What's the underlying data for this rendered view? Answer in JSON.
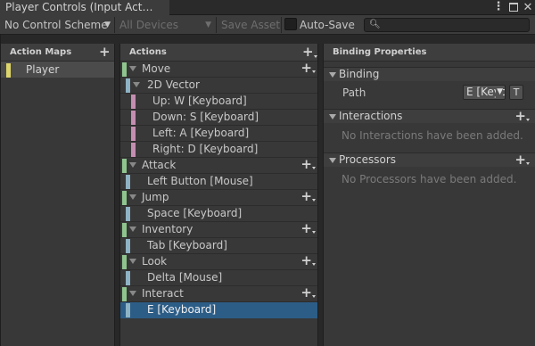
{
  "window": {
    "tab_title": "Player Controls (Input Act…",
    "kebab_glyph": "⋮",
    "close_glyph": "✕"
  },
  "toolbar": {
    "control_scheme": "No Control Scheme",
    "devices": "All Devices",
    "save_asset": "Save Asset",
    "auto_save": "Auto-Save",
    "search_placeholder": "",
    "auto_save_checked": false
  },
  "action_maps": {
    "header": "Action Maps",
    "items": [
      {
        "label": "Player",
        "color": "#ddd56b"
      }
    ]
  },
  "actions": {
    "header": "Actions",
    "colors": {
      "action": "#8fc48f",
      "binding": "#8eb3c4",
      "part": "#c48eb0"
    },
    "rows": [
      {
        "label": "Move",
        "kind": "action"
      },
      {
        "label": "2D Vector",
        "kind": "composite"
      },
      {
        "label": "Up: W [Keyboard]",
        "kind": "part"
      },
      {
        "label": "Down: S [Keyboard]",
        "kind": "part"
      },
      {
        "label": "Left: A [Keyboard]",
        "kind": "part"
      },
      {
        "label": "Right: D [Keyboard]",
        "kind": "part"
      },
      {
        "label": "Attack",
        "kind": "action"
      },
      {
        "label": "Left Button [Mouse]",
        "kind": "binding"
      },
      {
        "label": "Jump",
        "kind": "action"
      },
      {
        "label": "Space [Keyboard]",
        "kind": "binding"
      },
      {
        "label": "Inventory",
        "kind": "action"
      },
      {
        "label": "Tab [Keyboard]",
        "kind": "binding"
      },
      {
        "label": "Look",
        "kind": "action"
      },
      {
        "label": "Delta [Mouse]",
        "kind": "binding"
      },
      {
        "label": "Interact",
        "kind": "action"
      },
      {
        "label": "E [Keyboard]",
        "kind": "binding",
        "selected": true
      }
    ]
  },
  "binding_properties": {
    "header": "Binding Properties",
    "binding_section": "Binding",
    "path_label": "Path",
    "path_value": "E [Keyboard]",
    "t_button": "T",
    "interactions_section": "Interactions",
    "interactions_empty": "No Interactions have been added.",
    "processors_section": "Processors",
    "processors_empty": "No Processors have been added."
  }
}
